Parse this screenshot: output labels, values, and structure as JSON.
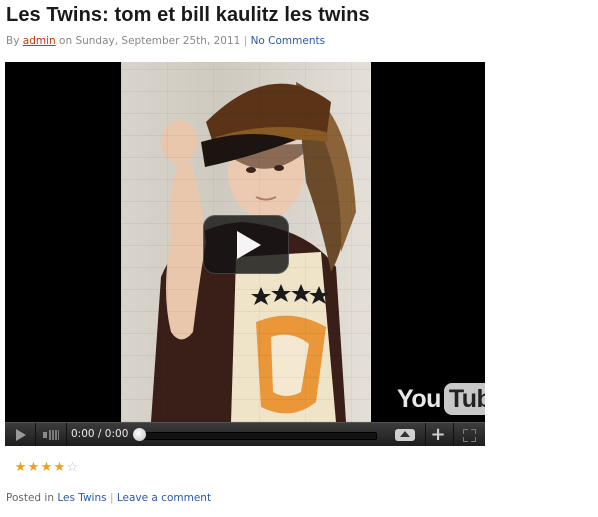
{
  "post": {
    "title": "Les Twins: tom et bill kaulitz les twins",
    "by_label": "By",
    "author": "admin",
    "on_label": "on",
    "date": "Sunday, September 25th, 2011",
    "separator": "|",
    "comments_link": "No Comments"
  },
  "video": {
    "logo_you": "You",
    "logo_tube": "Tube",
    "time_display": "0:00 / 0:00",
    "progress": 0
  },
  "rating": {
    "stars_filled": 4,
    "stars_total": 5,
    "colors": {
      "filled": "#e8a020",
      "empty": "#bbbbbb"
    }
  },
  "footer": {
    "posted_in_label": "Posted in",
    "category": "Les Twins",
    "separator": "|",
    "leave_comment": "Leave a comment"
  },
  "colors": {
    "title": "#1a1a1a",
    "author_link": "#c23b00",
    "link": "#2a5aa8"
  }
}
